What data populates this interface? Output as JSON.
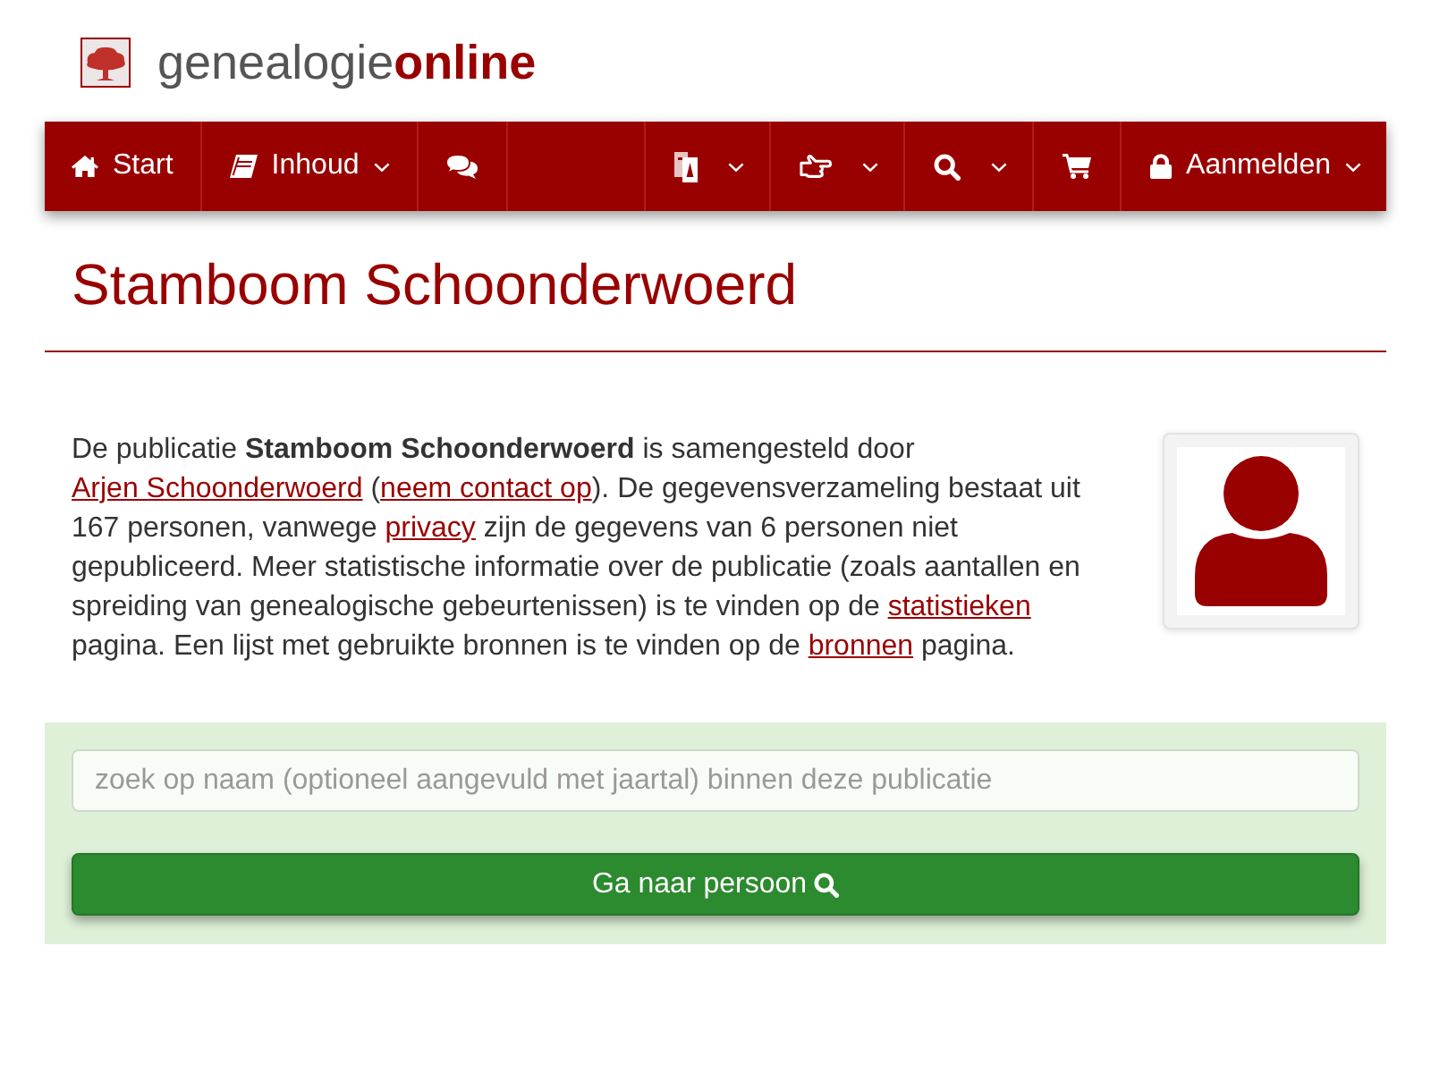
{
  "logo": {
    "text": "genealogie**online**"
  },
  "nav": {
    "left": [
      {
        "label": "Start",
        "dropdown": false
      },
      {
        "label": "Inhoud",
        "dropdown": true
      },
      {
        "dropdown": false
      }
    ],
    "right": [
      {
        "dropdown": true
      },
      {
        "dropdown": true
      },
      {
        "dropdown": true
      },
      {
        "dropdown": false
      },
      {
        "label": "Aanmelden",
        "dropdown": true
      }
    ]
  },
  "title": "Stamboom Schoonderwoerd",
  "intro": [
    {
      "kind": "text",
      "text": "De publicatie **Stamboom Schoonderwoerd** is samengesteld door "
    },
    {
      "kind": "link",
      "text": "Arjen Schoonderwoerd"
    },
    {
      "kind": "text",
      "text": " ("
    },
    {
      "kind": "link",
      "text": "neem contact op"
    },
    {
      "kind": "text",
      "text": "). De gegevensverzameling bestaat uit 167 personen, vanwege "
    },
    {
      "kind": "link",
      "text": "privacy"
    },
    {
      "kind": "text",
      "text": " zijn de gegevens van 6 personen niet gepubliceerd. Meer statistische informatie over de publicatie (zoals aantallen en spreiding van genealogische gebeurtenissen) is te vinden op de "
    },
    {
      "kind": "link",
      "text": "statistieken"
    },
    {
      "kind": "text",
      "text": " pagina. Een lijst met gebruikte bronnen is te vinden op de "
    },
    {
      "kind": "link",
      "text": "bronnen"
    },
    {
      "kind": "text",
      "text": " pagina."
    }
  ],
  "search": {
    "placeholder": "zoek op naam (optioneel aangevuld met jaartal) binnen deze publicatie",
    "button": "Ga naar persoon"
  }
}
